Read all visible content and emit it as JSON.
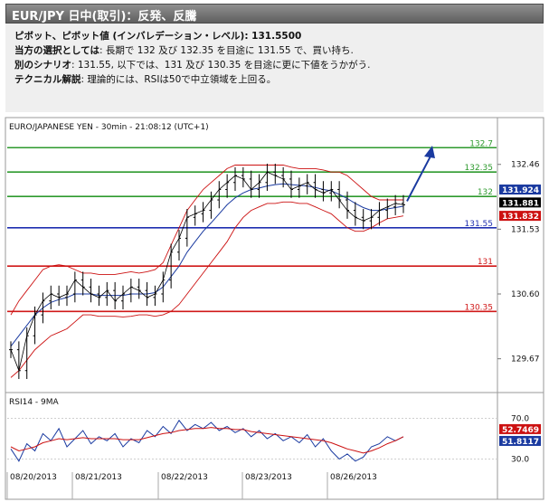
{
  "header": {
    "title": "EUR/JPY 日中(取引)：反発、反騰"
  },
  "info": {
    "line1_label": "ピボット、ピボット値 (インバレデーション・レベル): 131.5500",
    "line2_label": "当方の選択としては",
    "line2_text": ": 長期で 132 及び 132.35 を目途に 131.55 で、買い持ち.",
    "line3_label": "別のシナリオ",
    "line3_text": ": 131.55, 以下では、131 及び 130.35 を目途に更に下値をうかがう.",
    "line4_label": "テクニカル解説",
    "line4_text": ": 理論的には、RSIは50で中立領域を上回る。"
  },
  "colors": {
    "header_bg": "#6e6e6e",
    "info_bg": "#efefef",
    "resistance": "#2e9a2e",
    "pivot": "#1f2fb0",
    "support": "#d01818",
    "arrow": "#1a3aa0",
    "price": "#000000",
    "ma": "#1a3aa0",
    "bollinger": "#cc1111"
  },
  "chart_data": [
    {
      "type": "line",
      "title": "EURO/JAPANESE YEN - 30min - 21:08:12 (UTC+1)",
      "x_labels": [
        "08/20/2013",
        "08/21/2013",
        "08/22/2013",
        "08/23/2013",
        "08/26/2013"
      ],
      "y_ticks": [
        132.46,
        131.53,
        130.6,
        129.67
      ],
      "ylim": [
        129.25,
        132.95
      ],
      "levels": [
        {
          "label": "132.7",
          "value": 132.7,
          "role": "resistance"
        },
        {
          "label": "132.35",
          "value": 132.35,
          "role": "resistance"
        },
        {
          "label": "132",
          "value": 132.0,
          "role": "resistance"
        },
        {
          "label": "131.55",
          "value": 131.55,
          "role": "pivot"
        },
        {
          "label": "131",
          "value": 131.0,
          "role": "support"
        },
        {
          "label": "130.35",
          "value": 130.35,
          "role": "support"
        }
      ],
      "price_badges": [
        {
          "label": "131.924",
          "value": 131.924,
          "color": "#1a3aa0"
        },
        {
          "label": "131.881",
          "value": 131.881,
          "color": "#000000"
        },
        {
          "label": "131.832",
          "value": 131.832,
          "color": "#cc1111"
        }
      ],
      "price": [
        129.8,
        129.5,
        130.0,
        130.3,
        130.5,
        130.6,
        130.55,
        130.6,
        130.8,
        130.7,
        130.6,
        130.55,
        130.65,
        130.5,
        130.6,
        130.7,
        130.65,
        130.55,
        130.6,
        130.8,
        131.2,
        131.4,
        131.7,
        131.75,
        131.8,
        131.95,
        132.1,
        132.2,
        132.3,
        132.25,
        132.1,
        132.2,
        132.35,
        132.3,
        132.25,
        132.1,
        132.15,
        132.2,
        132.1,
        132.05,
        132.1,
        131.95,
        131.8,
        131.7,
        131.65,
        131.7,
        131.8,
        131.85,
        131.9,
        131.88
      ],
      "ma": [
        129.85,
        130.0,
        130.15,
        130.3,
        130.4,
        130.48,
        130.52,
        130.55,
        130.6,
        130.6,
        130.6,
        130.58,
        130.58,
        130.58,
        130.58,
        130.6,
        130.6,
        130.6,
        130.62,
        130.7,
        130.85,
        131.0,
        131.2,
        131.35,
        131.5,
        131.62,
        131.75,
        131.88,
        131.98,
        132.05,
        132.1,
        132.12,
        132.15,
        132.17,
        132.18,
        132.17,
        132.16,
        132.15,
        132.13,
        132.1,
        132.08,
        132.03,
        131.97,
        131.9,
        131.84,
        131.8,
        131.8,
        131.82,
        131.84,
        131.86
      ],
      "bb_upper": [
        130.3,
        130.5,
        130.65,
        130.8,
        130.95,
        131.0,
        131.02,
        131.0,
        130.95,
        130.9,
        130.9,
        130.88,
        130.88,
        130.88,
        130.9,
        130.92,
        130.9,
        130.92,
        130.95,
        131.05,
        131.3,
        131.55,
        131.8,
        131.95,
        132.1,
        132.2,
        132.3,
        132.4,
        132.45,
        132.45,
        132.45,
        132.45,
        132.45,
        132.45,
        132.45,
        132.42,
        132.4,
        132.4,
        132.4,
        132.38,
        132.35,
        132.35,
        132.3,
        132.2,
        132.1,
        132.0,
        131.95,
        131.95,
        131.95,
        131.95
      ],
      "bb_lower": [
        129.4,
        129.5,
        129.65,
        129.8,
        129.9,
        130.0,
        130.05,
        130.1,
        130.2,
        130.3,
        130.3,
        130.28,
        130.28,
        130.28,
        130.27,
        130.28,
        130.3,
        130.3,
        130.28,
        130.3,
        130.35,
        130.45,
        130.6,
        130.75,
        130.9,
        131.05,
        131.2,
        131.35,
        131.55,
        131.7,
        131.8,
        131.85,
        131.9,
        131.9,
        131.92,
        131.92,
        131.9,
        131.9,
        131.85,
        131.8,
        131.75,
        131.65,
        131.55,
        131.5,
        131.5,
        131.55,
        131.62,
        131.68,
        131.7,
        131.72
      ],
      "forecast_target": 132.73
    },
    {
      "type": "line",
      "title": "RSI14 - 9MA",
      "y_ticks": [
        70.0,
        30.0
      ],
      "ylim": [
        18,
        82
      ],
      "badges": [
        {
          "label": "52.7469",
          "value": 52.7469,
          "color": "#cc1111"
        },
        {
          "label": "51.8117",
          "value": 51.8117,
          "color": "#1a3aa0"
        }
      ],
      "rsi": [
        40,
        28,
        45,
        38,
        55,
        48,
        60,
        42,
        50,
        58,
        45,
        52,
        48,
        55,
        42,
        50,
        46,
        58,
        52,
        62,
        55,
        68,
        58,
        64,
        60,
        66,
        58,
        62,
        56,
        60,
        52,
        58,
        50,
        55,
        48,
        52,
        46,
        54,
        42,
        50,
        38,
        30,
        35,
        28,
        32,
        42,
        45,
        52,
        48,
        52
      ],
      "ma": [
        42,
        38,
        40,
        42,
        46,
        48,
        50,
        49,
        50,
        51,
        50,
        50,
        50,
        50,
        49,
        49,
        49,
        51,
        53,
        55,
        56,
        58,
        59,
        60,
        60,
        61,
        60,
        60,
        59,
        59,
        57,
        56,
        55,
        54,
        53,
        52,
        51,
        50,
        49,
        48,
        46,
        43,
        40,
        38,
        36,
        38,
        41,
        45,
        48,
        52
      ]
    }
  ]
}
